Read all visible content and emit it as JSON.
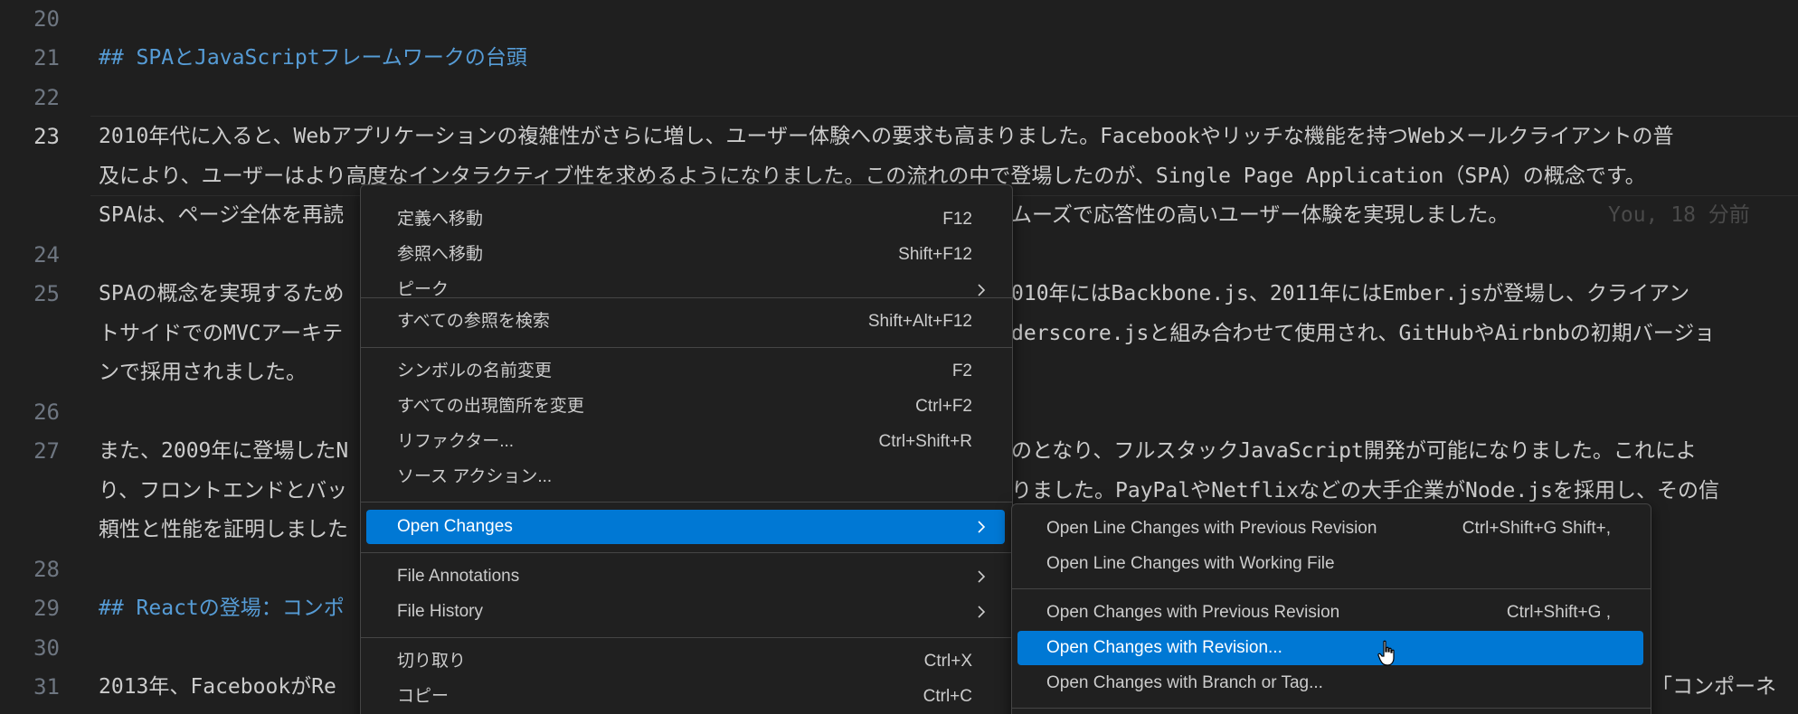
{
  "editor": {
    "blame": "You, 18 分前 ",
    "lines": [
      {
        "ln": "20",
        "text": ""
      },
      {
        "ln": "21",
        "text": "## SPAとJavaScriptフレームワークの台頭"
      },
      {
        "ln": "22",
        "text": ""
      },
      {
        "ln": "23",
        "text": "2010年代に入ると、Webアプリケーションの複雑性がさらに増し、ユーザー体験への要求も高まりました。Facebookやリッチな機能を持つWebメールクライアントの普"
      },
      {
        "ln": "",
        "text": "及により、ユーザーはより高度なインタラクティブ性を求めるようになりました。この流れの中で登場したのが、Single Page Application（SPA）の概念です。"
      },
      {
        "ln": "",
        "text": "SPAは、ページ全体を再読"
      },
      {
        "ln": "",
        "text": "ムーズで応答性の高いユーザー体験を実現しました。"
      },
      {
        "ln": "24",
        "text": ""
      },
      {
        "ln": "25",
        "text": "SPAの概念を実現するため"
      },
      {
        "ln": "",
        "text": "010年にはBackbone.js、2011年にはEmber.jsが登場し、クライアン"
      },
      {
        "ln": "",
        "text": "トサイドでのMVCアーキテ"
      },
      {
        "ln": "",
        "text": "derscore.jsと組み合わせて使用され、GitHubやAirbnbの初期バージョ"
      },
      {
        "ln": "",
        "text": "ンで採用されました。"
      },
      {
        "ln": "26",
        "text": ""
      },
      {
        "ln": "27",
        "text": "また、2009年に登場したN"
      },
      {
        "ln": "",
        "text": "のとなり、フルスタックJavaScript開発が可能になりました。これによ"
      },
      {
        "ln": "",
        "text": "り、フロントエンドとバッ"
      },
      {
        "ln": "",
        "text": "りました。PayPalやNetflixなどの大手企業がNode.jsを採用し、その信"
      },
      {
        "ln": "",
        "text": "頼性と性能を証明しました"
      },
      {
        "ln": "28",
        "text": ""
      },
      {
        "ln": "29",
        "text": "## Reactの登場：コンポ"
      },
      {
        "ln": "30",
        "text": ""
      },
      {
        "ln": "31",
        "text": "2013年、FacebookがRe"
      },
      {
        "ln": "",
        "text": "「コンポーネ"
      }
    ]
  },
  "context_menu": {
    "items": [
      {
        "label": "定義へ移動",
        "shortcut": "F12"
      },
      {
        "label": "参照へ移動",
        "shortcut": "Shift+F12"
      },
      {
        "label": "ピーク",
        "shortcut": ""
      },
      {
        "label": "すべての参照を検索",
        "shortcut": "Shift+Alt+F12"
      },
      {
        "label": "シンボルの名前変更",
        "shortcut": "F2"
      },
      {
        "label": "すべての出現箇所を変更",
        "shortcut": "Ctrl+F2"
      },
      {
        "label": "リファクター...",
        "shortcut": "Ctrl+Shift+R"
      },
      {
        "label": "ソース アクション...",
        "shortcut": ""
      },
      {
        "label": "Open Changes",
        "shortcut": ""
      },
      {
        "label": "File Annotations",
        "shortcut": ""
      },
      {
        "label": "File History",
        "shortcut": ""
      },
      {
        "label": "切り取り",
        "shortcut": "Ctrl+X"
      },
      {
        "label": "コピー",
        "shortcut": "Ctrl+C"
      }
    ]
  },
  "submenu": {
    "items": [
      {
        "label": "Open Line Changes with Previous Revision",
        "shortcut": "Ctrl+Shift+G Shift+,"
      },
      {
        "label": "Open Line Changes with Working File",
        "shortcut": ""
      },
      {
        "label": "Open Changes with Previous Revision",
        "shortcut": "Ctrl+Shift+G ,"
      },
      {
        "label": "Open Changes with Revision...",
        "shortcut": ""
      },
      {
        "label": "Open Changes with Branch or Tag...",
        "shortcut": ""
      }
    ]
  },
  "colors": {
    "background": "#1f1f1f",
    "heading": "#569cd6",
    "selection": "#0078d4",
    "menu_background": "#202020"
  }
}
